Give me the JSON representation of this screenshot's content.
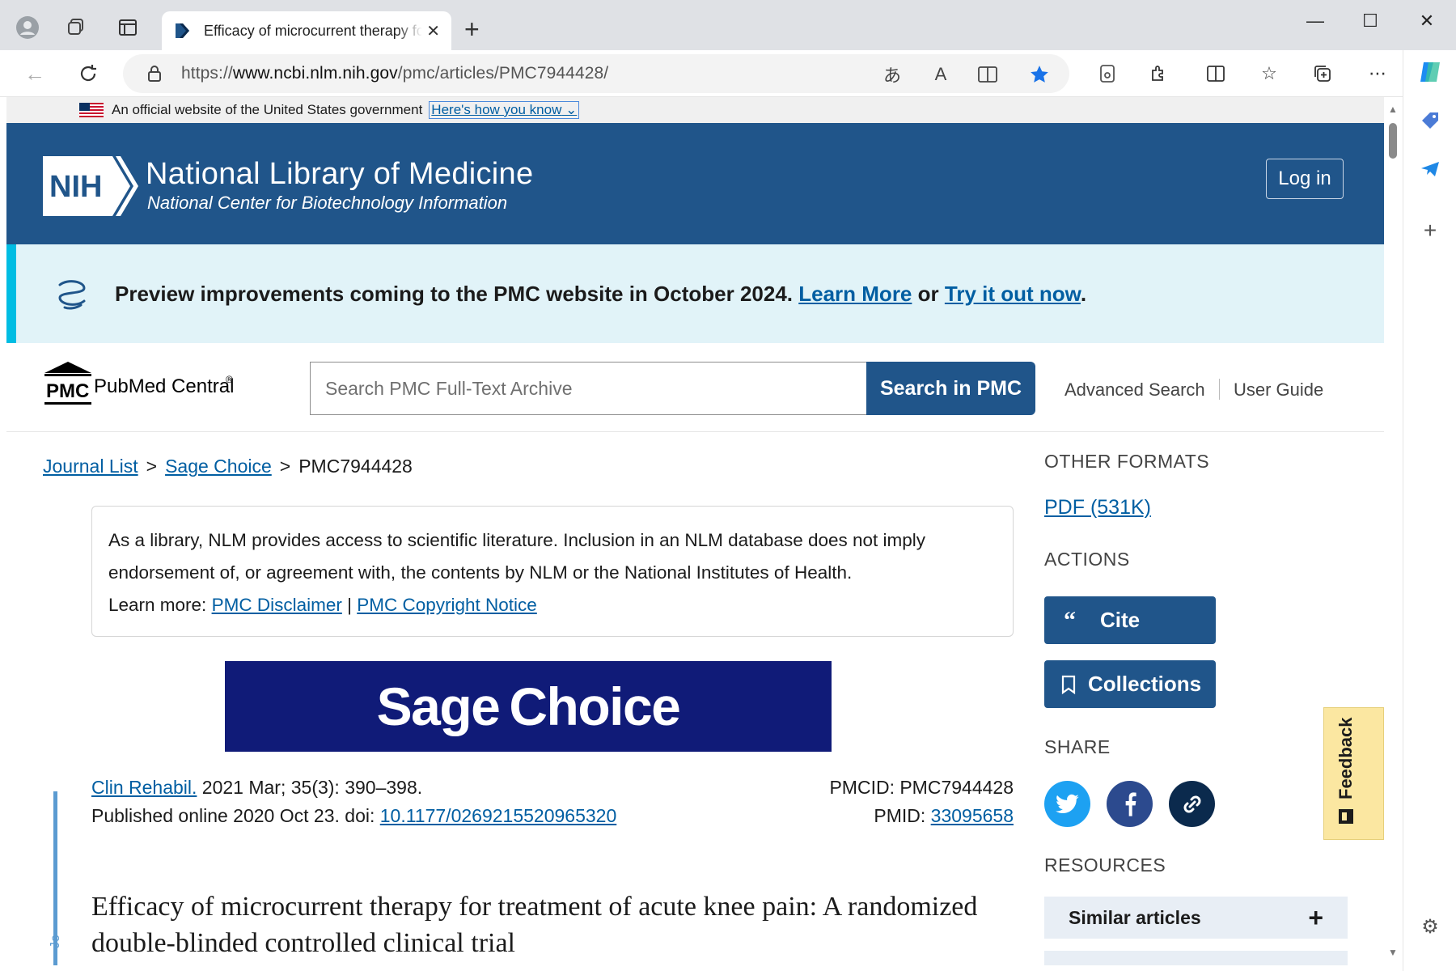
{
  "browser": {
    "tab_title": "Efficacy of microcurrent therapy for treatment of acute knee pain",
    "url_prefix": "https://",
    "url_domain": "www.ncbi.nlm.nih.gov",
    "url_path": "/pmc/articles/PMC7944428/",
    "window_controls": {
      "minimize": "—",
      "maximize": "☐",
      "close": "✕"
    }
  },
  "gov_banner": {
    "text": "An official website of the United States government",
    "link": "Here's how you know"
  },
  "header": {
    "badge": "NIH",
    "title": "National Library of Medicine",
    "subtitle": "National Center for Biotechnology Information",
    "login": "Log in"
  },
  "preview": {
    "text": "Preview improvements coming to the PMC website in October 2024.",
    "learn_more": "Learn More",
    "or": "or",
    "try_it": "Try it out now",
    "period": "."
  },
  "pmc": {
    "logo_abbr": "PMC",
    "logo_name": "PubMed Central",
    "logo_reg": "®",
    "search_placeholder": "Search PMC Full-Text Archive",
    "search_button": "Search in PMC",
    "advanced_search": "Advanced Search",
    "user_guide": "User Guide"
  },
  "breadcrumb": {
    "journal_list": "Journal List",
    "sage_choice": "Sage Choice",
    "current": "PMC7944428",
    "separator": ">"
  },
  "disclaimer": {
    "line1": "As a library, NLM provides access to scientific literature. Inclusion in an NLM database does not imply",
    "line2": "endorsement of, or agreement with, the contents by NLM or the National Institutes of Health.",
    "learn_more": "Learn more:",
    "pmc_disclaimer": "PMC Disclaimer",
    "pipe": "|",
    "copyright": "PMC Copyright Notice"
  },
  "journal_banner": {
    "word1": "Sage",
    "word2": "Choice"
  },
  "article": {
    "journal": "Clin Rehabil.",
    "citation": "2021 Mar; 35(3): 390–398.",
    "published": "Published online 2020 Oct 23. doi:",
    "doi": "10.1177/0269215520965320",
    "pmcid_label": "PMCID: PMC7944428",
    "pmid_label": "PMID:",
    "pmid": "33095658",
    "title": "Efficacy of microcurrent therapy for treatment of acute knee pain: A randomized double-blinded controlled clinical trial",
    "side_tab": "Jo"
  },
  "sidebar": {
    "other_formats": "OTHER FORMATS",
    "pdf": "PDF (531K)",
    "actions": "ACTIONS",
    "cite": "Cite",
    "collections": "Collections",
    "share": "SHARE",
    "resources": "RESOURCES",
    "similar_articles": "Similar articles",
    "plus": "+"
  },
  "feedback": "Feedback",
  "colors": {
    "nih_blue": "#20558a",
    "link_blue": "#005ea2",
    "preview_bg": "#e1f3f8",
    "preview_accent": "#00bde3",
    "sage_navy": "#101b78",
    "twitter": "#1da1f2",
    "facebook": "#2c4a8e",
    "link_share": "#0b2a4d",
    "feedback_bg": "#fbe7a1"
  }
}
